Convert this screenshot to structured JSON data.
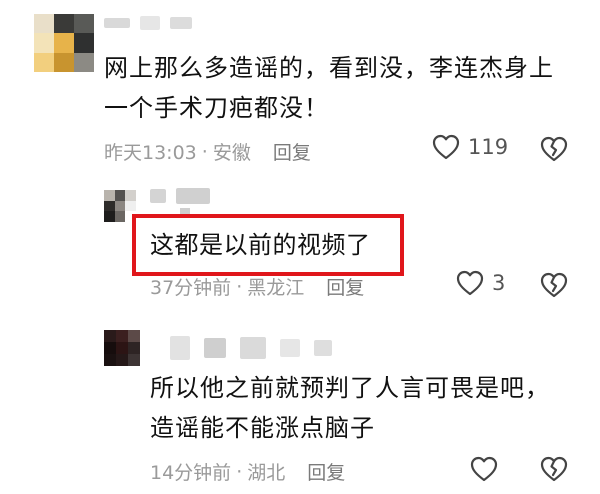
{
  "comments": [
    {
      "text_line1": "网上那么多造谣的，看到没，李连杰身上",
      "text_line2": "一个手术刀疤都没！",
      "time": "昨天13:03",
      "location": "安徽",
      "reply_label": "回复",
      "likes": "119"
    },
    {
      "text": "这都是以前的视频了",
      "time": "37分钟前",
      "location": "黑龙江",
      "reply_label": "回复",
      "likes": "3"
    },
    {
      "text_line1": "所以他之前就预判了人言可畏是吧，",
      "text_line2": "造谣能不能涨点脑子",
      "time": "14分钟前",
      "location": "湖北",
      "reply_label": "回复"
    }
  ],
  "separator": "·",
  "colors": {
    "highlight_border": "#e0161b",
    "meta_text": "#9a9a9a",
    "icon_stroke": "#444444"
  },
  "icons": {
    "like": "heart-outline-icon",
    "dislike": "broken-heart-icon"
  }
}
